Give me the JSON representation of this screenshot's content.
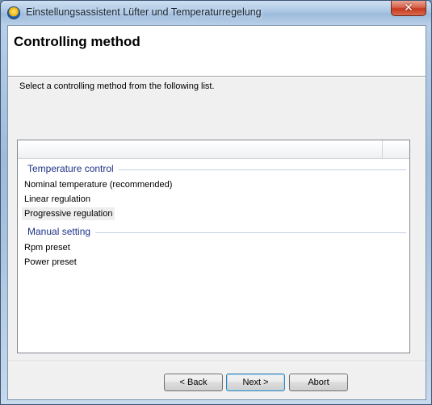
{
  "window": {
    "title": "Einstellungsassistent Lüfter und Temperaturregelung",
    "close_glyph": "✕",
    "icon": "app-icon"
  },
  "header": {
    "title": "Controlling method"
  },
  "instruction": "Select a controlling method from the following list.",
  "list": {
    "groups": [
      {
        "title": "Temperature control",
        "items": [
          "Nominal temperature (recommended)",
          "Linear regulation",
          "Progressive regulation"
        ]
      },
      {
        "title": "Manual setting",
        "items": [
          "Rpm preset",
          "Power preset"
        ]
      }
    ]
  },
  "buttons": {
    "back": "< Back",
    "next": "Next >",
    "abort": "Abort"
  },
  "colors": {
    "group_title": "#1e3287",
    "hover_row": "#eeeeee",
    "close_button": "#c4391f"
  }
}
